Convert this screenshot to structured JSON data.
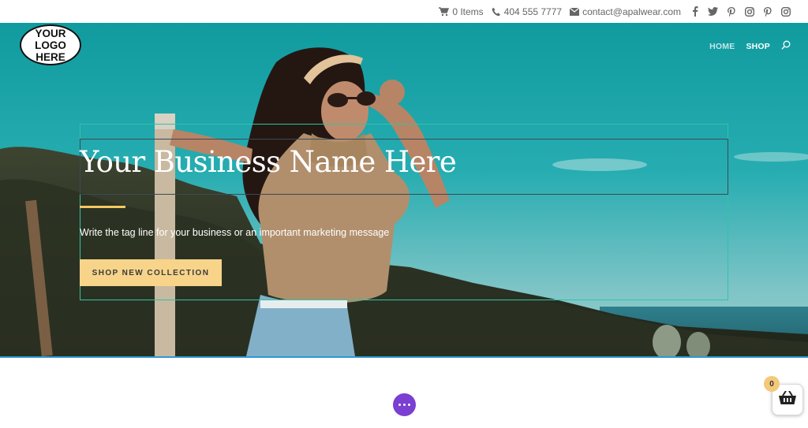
{
  "topbar": {
    "cart_label": "0 Items",
    "phone": "404 555 7777",
    "email": "contact@apalwear.com",
    "icons": [
      "cart-icon",
      "phone-icon",
      "envelope-icon"
    ],
    "social_icons": [
      "facebook-icon",
      "twitter-icon",
      "pinterest-icon",
      "instagram-icon",
      "pinterest-icon",
      "instagram-icon"
    ]
  },
  "header": {
    "logo_line1": "YOUR",
    "logo_line2": "LOGO HERE",
    "nav": [
      {
        "label": "HOME"
      },
      {
        "label": "SHOP"
      }
    ],
    "search_icon": "search-icon"
  },
  "hero": {
    "title": "Your Business Name Here",
    "tagline": "Write the tag line for your business or an important marketing message",
    "cta_label": "SHOP NEW COLLECTION"
  },
  "floating": {
    "cart_count": "0",
    "menu_icon": "more-dots-icon",
    "cart_icon": "basket-icon"
  },
  "colors": {
    "accent_gold": "#f6c85f",
    "cta_bg": "#f7d48a",
    "purple": "#7b3fd1",
    "sky_teal": "#1aa4a7"
  }
}
